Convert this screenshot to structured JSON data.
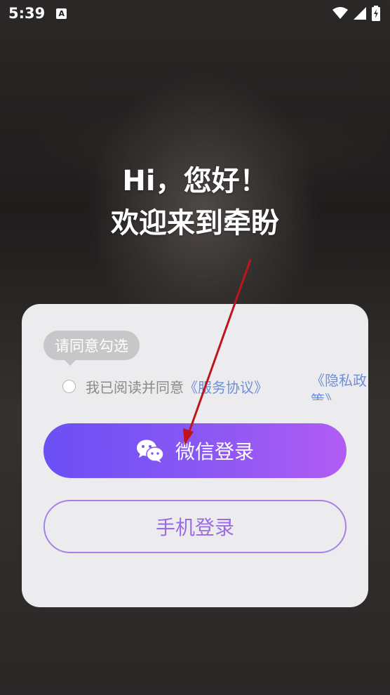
{
  "status_bar": {
    "time": "5:39",
    "notification_icon": "A"
  },
  "greeting": {
    "line1": "Hi，您好！",
    "line2": "欢迎来到牵盼"
  },
  "login_card": {
    "tooltip": "请同意勾选",
    "agreement_prefix": "我已阅读并同意",
    "terms_link": "《服务协议》",
    "privacy_link": "《隐私政策》",
    "wechat_login": "微信登录",
    "phone_login": "手机登录"
  },
  "colors": {
    "wechat_gradient_start": "#6b4ff5",
    "wechat_gradient_end": "#b15cf4",
    "phone_border": "#a682e6",
    "link": "#6f8fd8",
    "annotation_arrow": "#c0141c"
  },
  "icons": {
    "wifi": "wifi-icon",
    "signal": "signal-icon",
    "battery": "battery-charging-icon",
    "wechat": "wechat-icon"
  }
}
